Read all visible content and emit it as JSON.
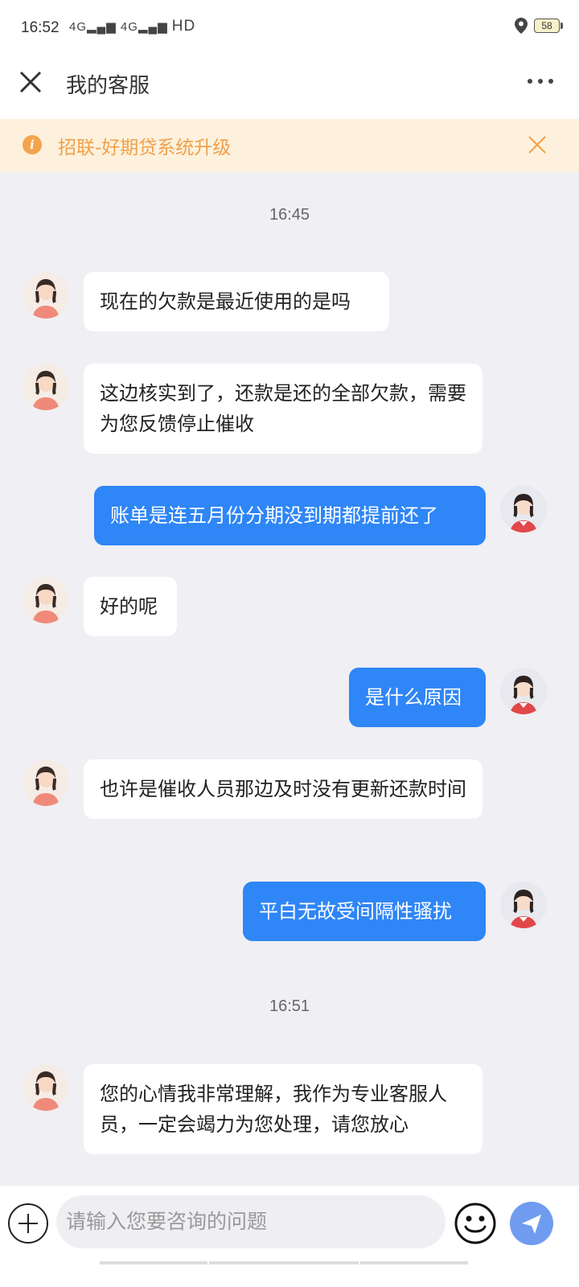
{
  "status_bar": {
    "time": "16:52",
    "signal_text": "4G",
    "hd_text": "HD",
    "battery": "58"
  },
  "header": {
    "title": "我的客服"
  },
  "notice": {
    "icon": "i",
    "text": "招联-好期贷系统升级"
  },
  "chat": {
    "timestamps": [
      "16:45",
      "16:51"
    ],
    "messages": [
      {
        "from": "agent",
        "text": "现在的欠款是最近使用的是吗"
      },
      {
        "from": "agent",
        "text": "这边核实到了，还款是还的全部欠款，需要为您反馈停止催收"
      },
      {
        "from": "user",
        "text": "账单是连五月份分期没到期都提前还了"
      },
      {
        "from": "agent",
        "text": "好的呢"
      },
      {
        "from": "user",
        "text": "是什么原因"
      },
      {
        "from": "agent",
        "text": "也许是催收人员那边及时没有更新还款时间"
      },
      {
        "from": "user",
        "text": "平白无故受间隔性骚扰"
      },
      {
        "from": "agent",
        "text": "您的心情我非常理解，我作为专业客服人员，一定会竭力为您处理，请您放心"
      }
    ]
  },
  "input": {
    "placeholder": "请输入您要咨询的问题"
  },
  "colors": {
    "user_bubble": "#2f86f6",
    "notice_text": "#f0a04a",
    "notice_bg": "#fdf1dd",
    "chat_bg": "#efeff4"
  }
}
